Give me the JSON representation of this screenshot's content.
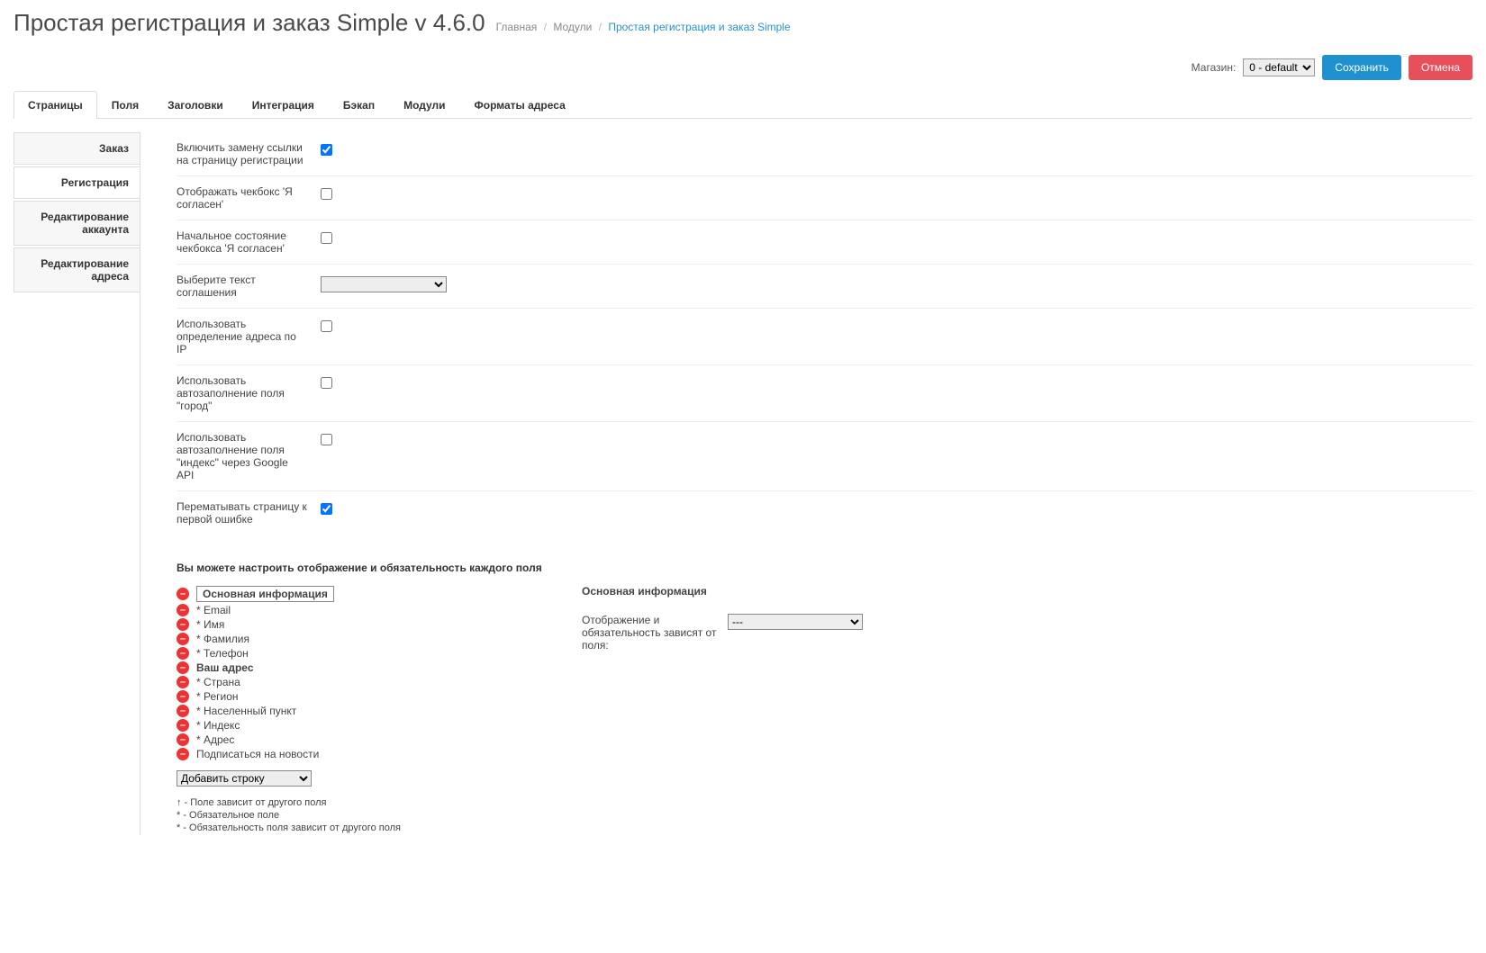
{
  "header": {
    "title": "Простая регистрация и заказ Simple v 4.6.0",
    "breadcrumb": {
      "home": "Главная",
      "modules": "Модули",
      "current": "Простая регистрация и заказ Simple"
    }
  },
  "toolbar": {
    "store_label": "Магазин:",
    "store_value": "0 - default",
    "save_label": "Сохранить",
    "cancel_label": "Отмена"
  },
  "top_tabs": [
    {
      "label": "Страницы",
      "active": true
    },
    {
      "label": "Поля",
      "active": false
    },
    {
      "label": "Заголовки",
      "active": false
    },
    {
      "label": "Интеграция",
      "active": false
    },
    {
      "label": "Бэкап",
      "active": false
    },
    {
      "label": "Модули",
      "active": false
    },
    {
      "label": "Форматы адреса",
      "active": false
    }
  ],
  "side_tabs": [
    {
      "label": "Заказ",
      "active": false
    },
    {
      "label": "Регистрация",
      "active": true
    },
    {
      "label": "Редактирование аккаунта",
      "active": false
    },
    {
      "label": "Редактирование адреса",
      "active": false
    }
  ],
  "settings": [
    {
      "label": "Включить замену ссылки на страницу регистрации",
      "type": "checkbox",
      "checked": true
    },
    {
      "label": "Отображать чекбокс 'Я согласен'",
      "type": "checkbox",
      "checked": false
    },
    {
      "label": "Начальное состояние чекбокса 'Я согласен'",
      "type": "checkbox",
      "checked": false
    },
    {
      "label": "Выберите текст соглашения",
      "type": "select",
      "value": ""
    },
    {
      "label": "Использовать определение адреса по IP",
      "type": "checkbox",
      "checked": false
    },
    {
      "label": "Использовать автозаполнение поля \"город\"",
      "type": "checkbox",
      "checked": false
    },
    {
      "label": "Использовать автозаполнение поля \"индекс\" через Google API",
      "type": "checkbox",
      "checked": false
    },
    {
      "label": "Перематывать страницу к первой ошибке",
      "type": "checkbox",
      "checked": true
    }
  ],
  "fields": {
    "intro": "Вы можете настроить отображение и обязательность каждого поля",
    "items": [
      {
        "label": "Основная информация",
        "bold": true,
        "selected": true
      },
      {
        "label": "* Email"
      },
      {
        "label": "* Имя"
      },
      {
        "label": "* Фамилия"
      },
      {
        "label": "* Телефон"
      },
      {
        "label": "Ваш адрес",
        "bold": true
      },
      {
        "label": "* Страна"
      },
      {
        "label": "* Регион"
      },
      {
        "label": "* Населенный пункт"
      },
      {
        "label": "* Индекс"
      },
      {
        "label": "* Адрес"
      },
      {
        "label": "Подписаться на новости"
      }
    ],
    "add_row": "Добавить строку",
    "legend": {
      "l1": "↑ - Поле зависит от другого поля",
      "l2": "* - Обязательное поле",
      "l3": "* - Обязательность поля зависит от другого поля"
    },
    "detail": {
      "title": "Основная информация",
      "depend_label": "Отображение и обязательность зависят от поля:",
      "depend_value": "---"
    }
  }
}
